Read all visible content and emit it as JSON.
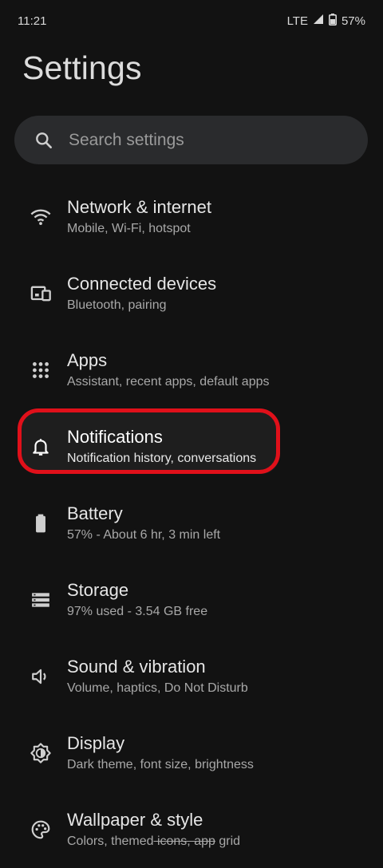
{
  "status_bar": {
    "time": "11:21",
    "network": "LTE",
    "battery": "57%"
  },
  "page_title": "Settings",
  "search": {
    "placeholder": "Search settings"
  },
  "items": [
    {
      "title": "Network & internet",
      "subtitle": "Mobile, Wi-Fi, hotspot",
      "icon": "wifi-icon"
    },
    {
      "title": "Connected devices",
      "subtitle": "Bluetooth, pairing",
      "icon": "connected-devices-icon"
    },
    {
      "title": "Apps",
      "subtitle": "Assistant, recent apps, default apps",
      "icon": "apps-grid-icon"
    },
    {
      "title": "Notifications",
      "subtitle": "Notification history, conversations",
      "icon": "bell-icon",
      "highlighted": true
    },
    {
      "title": "Battery",
      "subtitle": "57% - About 6 hr, 3 min left",
      "icon": "battery-icon"
    },
    {
      "title": "Storage",
      "subtitle": "97% used - 3.54 GB free",
      "icon": "storage-icon"
    },
    {
      "title": "Sound & vibration",
      "subtitle": "Volume, haptics, Do Not Disturb",
      "icon": "speaker-icon"
    },
    {
      "title": "Display",
      "subtitle": "Dark theme, font size, brightness",
      "icon": "brightness-icon"
    },
    {
      "title": "Wallpaper & style",
      "subtitle_parts": [
        "Colors, themed",
        " icons, app",
        " grid"
      ],
      "icon": "palette-icon"
    }
  ],
  "colors": {
    "background": "#121212",
    "search_bg": "#2a2b2d",
    "highlight_ring": "#e0101a"
  }
}
